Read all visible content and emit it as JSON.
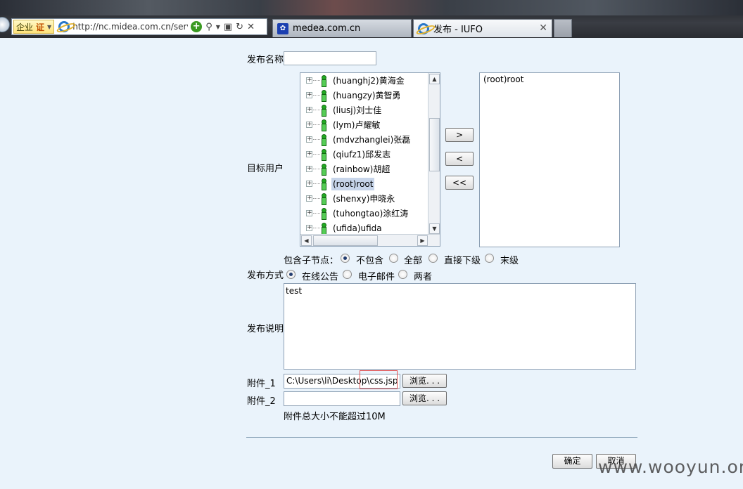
{
  "browser": {
    "enterprise_label": "企业",
    "cert_label": "证",
    "url": "http://nc.midea.com.cn/servi",
    "tabs": [
      {
        "title": "medea.com.cn"
      },
      {
        "title": "发布 - IUFO"
      }
    ]
  },
  "form": {
    "publish_name_label": "发布名称",
    "publish_name_value": "",
    "target_users_label": "目标用户",
    "tree_items": [
      {
        "label": "(huanghj2)黄海金",
        "selected": false
      },
      {
        "label": "(huangzy)黄智勇",
        "selected": false
      },
      {
        "label": "(liusj)刘士佳",
        "selected": false
      },
      {
        "label": "(lym)卢耀敏",
        "selected": false
      },
      {
        "label": "(mdvzhanglei)张磊",
        "selected": false
      },
      {
        "label": "(qiufz1)邱发志",
        "selected": false
      },
      {
        "label": "(rainbow)胡超",
        "selected": false
      },
      {
        "label": "(root)root",
        "selected": true
      },
      {
        "label": "(shenxy)申晓永",
        "selected": false
      },
      {
        "label": "(tuhongtao)涂红涛",
        "selected": false
      },
      {
        "label": "(ufida)ufida",
        "selected": false
      }
    ],
    "move_buttons": {
      "add": ">",
      "remove": "<",
      "remove_all": "<<"
    },
    "selected_users": [
      "(root)root"
    ],
    "include_children_label": "包含子节点：",
    "include_options": [
      {
        "label": "不包含",
        "checked": true
      },
      {
        "label": "全部",
        "checked": false
      },
      {
        "label": "直接下级",
        "checked": false
      },
      {
        "label": "末级",
        "checked": false
      }
    ],
    "publish_method_label": "发布方式",
    "method_options": [
      {
        "label": "在线公告",
        "checked": true
      },
      {
        "label": "电子邮件",
        "checked": false
      },
      {
        "label": "两者",
        "checked": false
      }
    ],
    "description_label": "发布说明",
    "description_value": "test",
    "attachment1_label": "附件_1",
    "attachment1_value": "C:\\Users\\li\\Desktop\\css.jsp",
    "attachment2_label": "附件_2",
    "attachment2_value": "",
    "browse_label": "浏览. . .",
    "size_note": "附件总大小不能超过10M",
    "ok_label": "确定",
    "cancel_label": "取消"
  },
  "watermark": "www.wooyun.org"
}
